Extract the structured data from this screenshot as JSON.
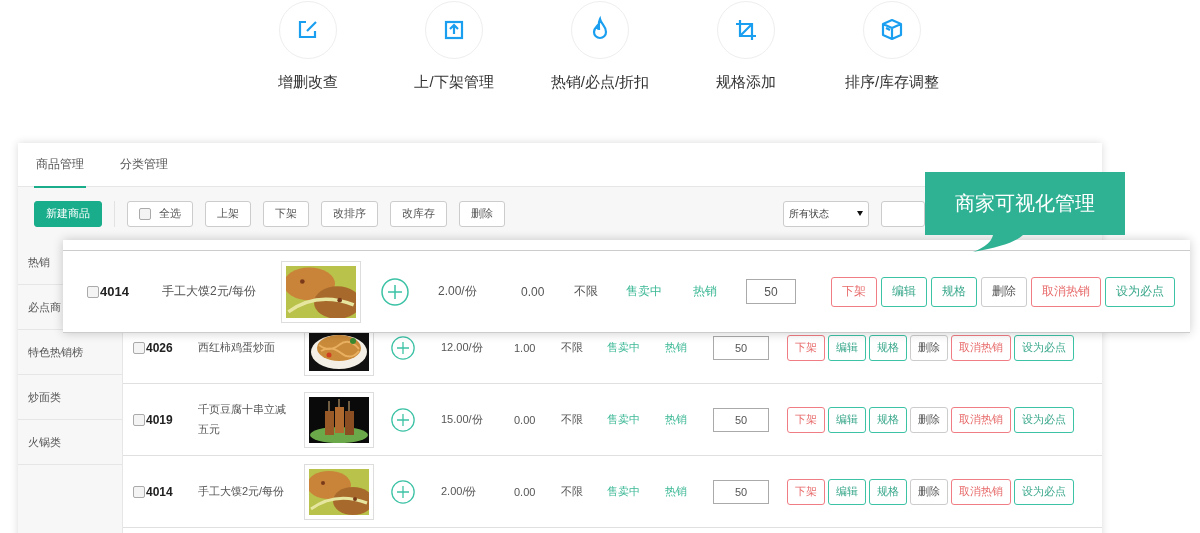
{
  "features": [
    {
      "label": "增删改查"
    },
    {
      "label": "上/下架管理"
    },
    {
      "label": "热销/必点/折扣"
    },
    {
      "label": "规格添加"
    },
    {
      "label": "排序/库存调整"
    }
  ],
  "tabs": [
    {
      "label": "商品管理",
      "selected": true
    },
    {
      "label": "分类管理",
      "selected": false
    }
  ],
  "toolbar": {
    "primary_button": "新建商品",
    "select_all": {
      "label": "全选",
      "checked": false
    },
    "buttons": [
      "上架",
      "下架",
      "改排序",
      "改库存",
      "删除"
    ],
    "status_select": {
      "value": "所有状态"
    }
  },
  "sidebar": {
    "items": [
      "热销",
      "必点商",
      "特色热销榜",
      "炒面类",
      "火锅类"
    ]
  },
  "callout": "商家可视化管理",
  "featured_row": {
    "id": "4014",
    "checked": false,
    "name": "手工大馍2元/每份",
    "price": "2.00/份",
    "column_6": "0.00",
    "stock": "不限",
    "status": "售卖中",
    "tag": "热销",
    "quantity": "50",
    "actions": [
      {
        "label": "下架",
        "kind": "danger"
      },
      {
        "label": "编辑",
        "kind": "primary"
      },
      {
        "label": "规格",
        "kind": "primary"
      },
      {
        "label": "删除",
        "kind": "default"
      },
      {
        "label": "取消热销",
        "kind": "danger"
      },
      {
        "label": "设为必点",
        "kind": "primary"
      }
    ]
  },
  "rows": [
    {
      "id": "4026",
      "checked": false,
      "name": "西红柿鸡蛋炒面",
      "price": "12.00/份",
      "column_6": "1.00",
      "stock": "不限",
      "status": "售卖中",
      "tag": "热销",
      "quantity": "50",
      "actions": [
        {
          "label": "下架",
          "kind": "danger"
        },
        {
          "label": "编辑",
          "kind": "primary"
        },
        {
          "label": "规格",
          "kind": "primary"
        },
        {
          "label": "删除",
          "kind": "default"
        },
        {
          "label": "取消热销",
          "kind": "danger"
        },
        {
          "label": "设为必点",
          "kind": "primary"
        }
      ]
    },
    {
      "id": "4019",
      "checked": false,
      "name": "千页豆腐十串立减五元",
      "price": "15.00/份",
      "column_6": "0.00",
      "stock": "不限",
      "status": "售卖中",
      "tag": "热销",
      "quantity": "50",
      "actions": [
        {
          "label": "下架",
          "kind": "danger"
        },
        {
          "label": "编辑",
          "kind": "primary"
        },
        {
          "label": "规格",
          "kind": "primary"
        },
        {
          "label": "删除",
          "kind": "default"
        },
        {
          "label": "取消热销",
          "kind": "danger"
        },
        {
          "label": "设为必点",
          "kind": "primary"
        }
      ]
    },
    {
      "id": "4014",
      "checked": false,
      "name": "手工大馍2元/每份",
      "price": "2.00/份",
      "column_6": "0.00",
      "stock": "不限",
      "status": "售卖中",
      "tag": "热销",
      "quantity": "50",
      "actions": [
        {
          "label": "下架",
          "kind": "danger"
        },
        {
          "label": "编辑",
          "kind": "primary"
        },
        {
          "label": "规格",
          "kind": "primary"
        },
        {
          "label": "删除",
          "kind": "default"
        },
        {
          "label": "取消热销",
          "kind": "danger"
        },
        {
          "label": "设为必点",
          "kind": "primary"
        }
      ]
    }
  ]
}
